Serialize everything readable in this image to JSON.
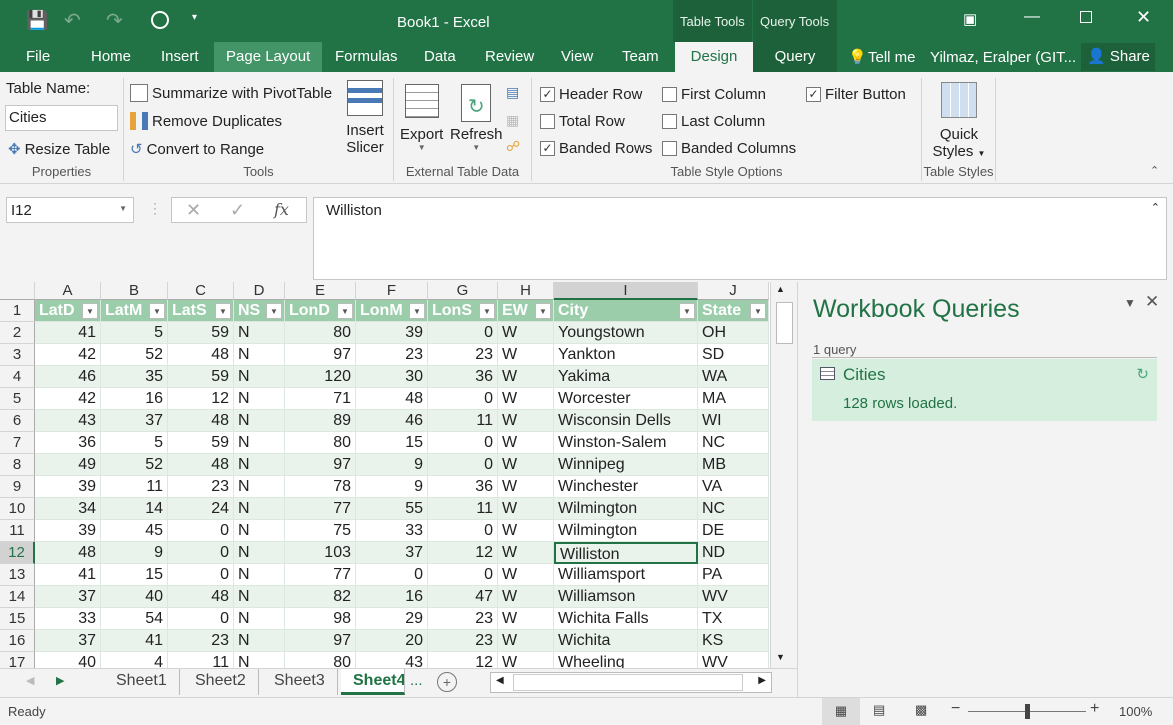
{
  "window": {
    "title": "Book1 - Excel",
    "context_tabs": [
      "Table Tools",
      "Query Tools"
    ],
    "user": "Yilmaz, Eralper (GIT...",
    "share": "Share",
    "tell_me": "Tell me"
  },
  "tabs": [
    "File",
    "Home",
    "Insert",
    "Page Layout",
    "Formulas",
    "Data",
    "Review",
    "View",
    "Team",
    "Design",
    "Query"
  ],
  "ribbon": {
    "properties": {
      "label": "Properties",
      "table_name_label": "Table Name:",
      "table_name_value": "Cities",
      "resize": "Resize Table"
    },
    "tools": {
      "label": "Tools",
      "summarize": "Summarize with PivotTable",
      "remove_dup": "Remove Duplicates",
      "convert": "Convert to Range",
      "insert_slicer_1": "Insert",
      "insert_slicer_2": "Slicer"
    },
    "external": {
      "label": "External Table Data",
      "export": "Export",
      "refresh": "Refresh"
    },
    "style_options": {
      "label": "Table Style Options",
      "items": [
        {
          "label": "Header Row",
          "checked": true
        },
        {
          "label": "Total Row",
          "checked": false
        },
        {
          "label": "Banded Rows",
          "checked": true
        },
        {
          "label": "First Column",
          "checked": false
        },
        {
          "label": "Last Column",
          "checked": false
        },
        {
          "label": "Banded Columns",
          "checked": false
        },
        {
          "label": "Filter Button",
          "checked": true
        }
      ]
    },
    "styles": {
      "label": "Table Styles",
      "quick_1": "Quick",
      "quick_2": "Styles"
    }
  },
  "formula_bar": {
    "name_box": "I12",
    "fx": "fx",
    "value": "Williston"
  },
  "grid": {
    "columns": [
      "A",
      "B",
      "C",
      "D",
      "E",
      "F",
      "G",
      "H",
      "I",
      "J"
    ],
    "headers": [
      "LatD",
      "LatM",
      "LatS",
      "NS",
      "LonD",
      "LonM",
      "LonS",
      "EW",
      "City",
      "State"
    ],
    "selected_cell": "I12",
    "rows": [
      [
        41,
        5,
        59,
        "N",
        80,
        39,
        0,
        "W",
        "Youngstown",
        "OH"
      ],
      [
        42,
        52,
        48,
        "N",
        97,
        23,
        23,
        "W",
        "Yankton",
        "SD"
      ],
      [
        46,
        35,
        59,
        "N",
        120,
        30,
        36,
        "W",
        "Yakima",
        "WA"
      ],
      [
        42,
        16,
        12,
        "N",
        71,
        48,
        0,
        "W",
        "Worcester",
        "MA"
      ],
      [
        43,
        37,
        48,
        "N",
        89,
        46,
        11,
        "W",
        "Wisconsin Dells",
        "WI"
      ],
      [
        36,
        5,
        59,
        "N",
        80,
        15,
        0,
        "W",
        "Winston-Salem",
        "NC"
      ],
      [
        49,
        52,
        48,
        "N",
        97,
        9,
        0,
        "W",
        "Winnipeg",
        "MB"
      ],
      [
        39,
        11,
        23,
        "N",
        78,
        9,
        36,
        "W",
        "Winchester",
        "VA"
      ],
      [
        34,
        14,
        24,
        "N",
        77,
        55,
        11,
        "W",
        "Wilmington",
        "NC"
      ],
      [
        39,
        45,
        0,
        "N",
        75,
        33,
        0,
        "W",
        "Wilmington",
        "DE"
      ],
      [
        48,
        9,
        0,
        "N",
        103,
        37,
        12,
        "W",
        "Williston",
        "ND"
      ],
      [
        41,
        15,
        0,
        "N",
        77,
        0,
        0,
        "W",
        "Williamsport",
        "PA"
      ],
      [
        37,
        40,
        48,
        "N",
        82,
        16,
        47,
        "W",
        "Williamson",
        "WV"
      ],
      [
        33,
        54,
        0,
        "N",
        98,
        29,
        23,
        "W",
        "Wichita Falls",
        "TX"
      ],
      [
        37,
        41,
        23,
        "N",
        97,
        20,
        23,
        "W",
        "Wichita",
        "KS"
      ],
      [
        40,
        4,
        11,
        "N",
        80,
        43,
        12,
        "W",
        "Wheeling",
        "WV"
      ]
    ]
  },
  "sheets": [
    "Sheet1",
    "Sheet2",
    "Sheet3",
    "Sheet4"
  ],
  "active_sheet": "Sheet4",
  "sheet_more": "...",
  "pane": {
    "title": "Workbook Queries",
    "count": "1 query",
    "query_name": "Cities",
    "query_status": "128 rows loaded."
  },
  "status": {
    "text": "Ready",
    "zoom": "100%",
    "zoom_level": 100
  },
  "colors": {
    "accent": "#217346",
    "header_fill": "#9ccdab",
    "band_fill": "#e9f3ec"
  }
}
